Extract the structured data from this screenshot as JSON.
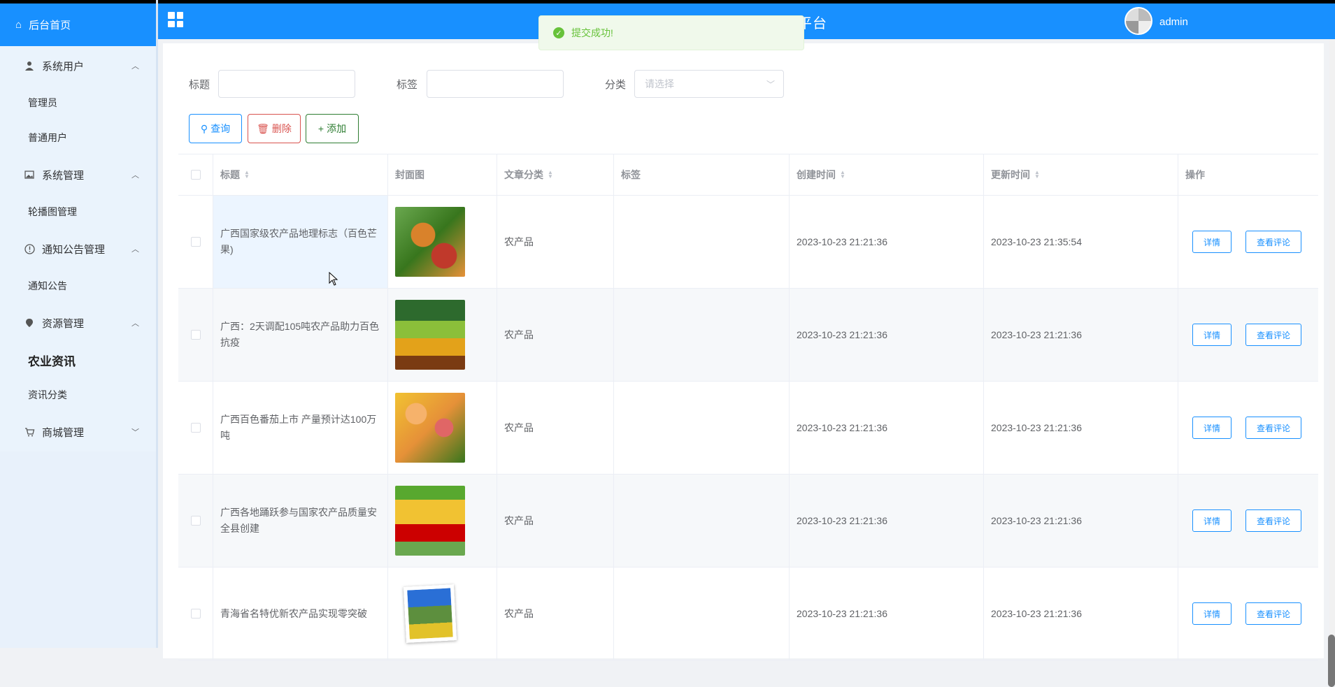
{
  "header": {
    "title": "农业信息小程序助农平台",
    "user": "admin"
  },
  "toast": {
    "message": "提交成功!"
  },
  "sidebar": {
    "home": "后台首页",
    "groups": [
      {
        "label": "系统用户",
        "icon": "user-icon",
        "items": [
          "管理员",
          "普通用户"
        ]
      },
      {
        "label": "系统管理",
        "icon": "image-icon",
        "items": [
          "轮播图管理"
        ]
      },
      {
        "label": "通知公告管理",
        "icon": "info-circle-icon",
        "items": [
          "通知公告"
        ]
      },
      {
        "label": "资源管理",
        "icon": "location-icon",
        "items": [
          "农业资讯",
          "资讯分类"
        ],
        "active": "农业资讯"
      },
      {
        "label": "商城管理",
        "icon": "cart-icon",
        "items": []
      }
    ]
  },
  "filters": {
    "title_label": "标题",
    "tag_label": "标签",
    "category_label": "分类",
    "category_placeholder": "请选择"
  },
  "buttons": {
    "query": "查询",
    "delete": "删除",
    "add": "添加"
  },
  "table": {
    "columns": [
      "标题",
      "封面图",
      "文章分类",
      "标签",
      "创建时间",
      "更新时间",
      "操作"
    ],
    "rows": [
      {
        "title": "广西国家级农产品地理标志（百色芒果)",
        "category": "农产品",
        "tag": "",
        "created": "2023-10-23 21:21:36",
        "updated": "2023-10-23 21:35:54"
      },
      {
        "title": "广西：2天调配105吨农产品助力百色抗疫",
        "category": "农产品",
        "tag": "",
        "created": "2023-10-23 21:21:36",
        "updated": "2023-10-23 21:21:36"
      },
      {
        "title": "广西百色番茄上市 产量预计达100万吨",
        "category": "农产品",
        "tag": "",
        "created": "2023-10-23 21:21:36",
        "updated": "2023-10-23 21:21:36"
      },
      {
        "title": "广西各地踊跃参与国家农产品质量安全县创建",
        "category": "农产品",
        "tag": "",
        "created": "2023-10-23 21:21:36",
        "updated": "2023-10-23 21:21:36"
      },
      {
        "title": "青海省名特优新农产品实现零突破",
        "category": "农产品",
        "tag": "",
        "created": "2023-10-23 21:21:36",
        "updated": "2023-10-23 21:21:36"
      }
    ],
    "actions": {
      "detail": "详情",
      "comments": "查看评论"
    }
  },
  "colors": {
    "primary": "#1890ff",
    "sidebar_bg": "#e8f1fb",
    "success": "#67c23a",
    "danger": "#d9534f",
    "add": "#2e7d32"
  }
}
